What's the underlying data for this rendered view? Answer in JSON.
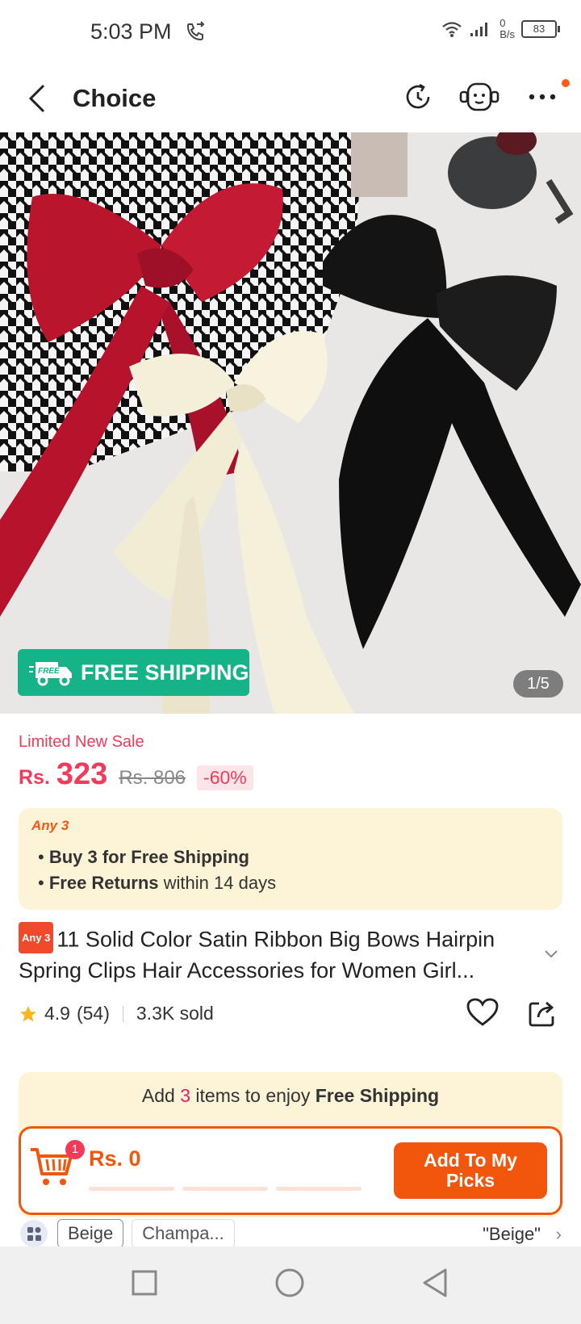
{
  "status_bar": {
    "time": "5:03 PM",
    "net_speed_value": "0",
    "net_speed_unit": "B/s",
    "battery": "83"
  },
  "header": {
    "title": "Choice"
  },
  "gallery": {
    "free_shipping": "FREE SHIPPING",
    "free_badge_text": "FREE",
    "counter": "1/5"
  },
  "price": {
    "sale_label": "Limited New Sale",
    "currency": "Rs.",
    "current": "323",
    "original": "Rs. 806",
    "discount": "-60%"
  },
  "promo": {
    "tag": "Any 3",
    "line1_bold": "Buy 3 for  Free Shipping",
    "line2_bold": "Free Returns",
    "line2_rest": " within 14 days"
  },
  "product": {
    "badge": "Any 3",
    "title": "11 Solid Color Satin Ribbon Big Bows Hairpin Spring Clips Hair Accessories for Women Girl...",
    "rating": "4.9",
    "reviews": "(54)",
    "sold": "3.3K sold"
  },
  "cart": {
    "msg_prefix": "Add ",
    "msg_count": "3",
    "msg_mid": " items to enjoy ",
    "msg_bold": "Free Shipping",
    "badge": "1",
    "total": "Rs. 0",
    "button_line1": "Add To My",
    "button_line2": "Picks"
  },
  "variants": {
    "chips": [
      "Beige",
      "Champa..."
    ],
    "selected": "\"Beige\""
  },
  "colors": {
    "accent": "#f2560d",
    "price": "#f23b5a",
    "ship_green": "#15b387",
    "promo_bg": "#fdf3d6"
  }
}
